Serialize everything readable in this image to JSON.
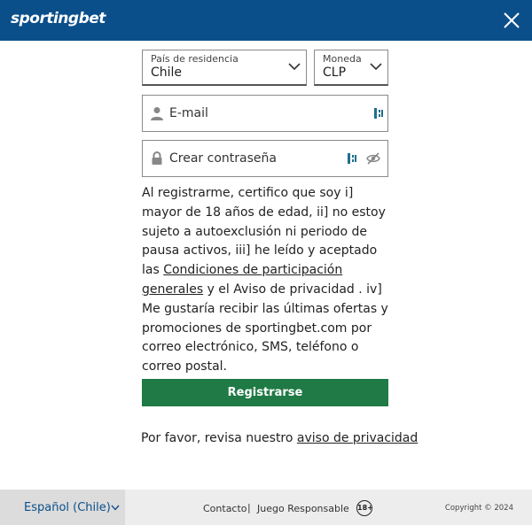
{
  "header": {
    "logo_text_a": "sporting",
    "logo_text_b": "bet",
    "bg_color": "#0b4f8a"
  },
  "form": {
    "country": {
      "label": "País de residencia",
      "value": "Chile"
    },
    "currency": {
      "label": "Moneda",
      "value": "CLP"
    },
    "email": {
      "placeholder": "E-mail"
    },
    "password": {
      "placeholder": "Crear contraseña"
    }
  },
  "terms": {
    "text_1": "Al registrarme, certifico que soy i] mayor de 18 años de edad, ii] no estoy sujeto a autoexclusión ni periodo de pausa activos, iii] he leído y aceptado las ",
    "link_conditions": "Condiciones de participación generales",
    "text_2": " y el Aviso de privacidad . iv] Me gustaría recibir las últimas ofertas y promociones de sportingbet.com por correo electrónico, SMS, teléfono o correo postal."
  },
  "register_button": {
    "label": "Registrarse",
    "color": "#1f7a45"
  },
  "privacy": {
    "text": "Por favor, revisa nuestro ",
    "link": "aviso de privacidad"
  },
  "footer": {
    "language": "Español (Chile)",
    "contact": "Contacto",
    "separator": "|",
    "responsible": "Juego Responsable",
    "age_badge": "18+",
    "copyright": "Copyright © 2024"
  }
}
